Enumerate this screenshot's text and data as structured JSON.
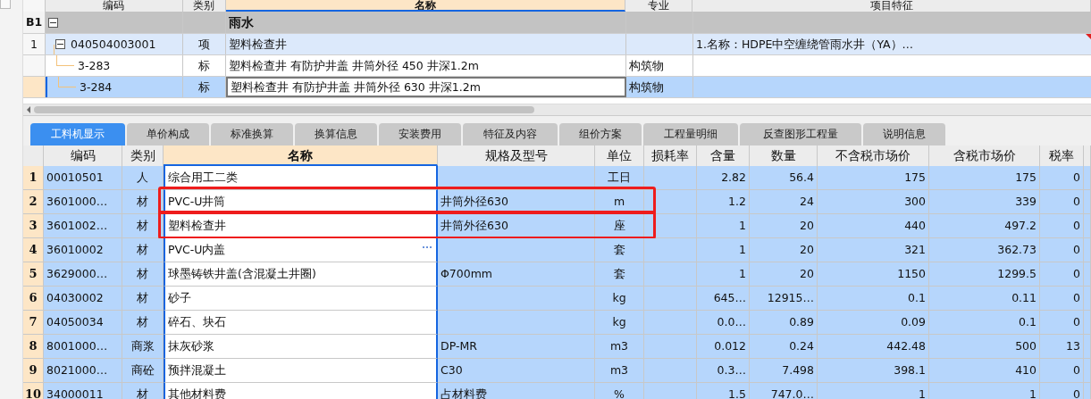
{
  "upper": {
    "columns": [
      {
        "label": "编码",
        "selected": false
      },
      {
        "label": "类别",
        "selected": false
      },
      {
        "label": "名称",
        "selected": true
      },
      {
        "label": "专业",
        "selected": false
      },
      {
        "label": "项目特征",
        "selected": false
      }
    ],
    "rows": [
      {
        "kind": "group",
        "index": "B1",
        "code": "",
        "type": "",
        "name": "雨水",
        "major": "",
        "feature": "",
        "expanded": true,
        "selected": false
      },
      {
        "kind": "item",
        "index": "1",
        "code": "040504003001",
        "type": "项",
        "name": "塑料检查井",
        "major": "",
        "feature": "1.名称：HDPE中空缠绕管雨水井（YA）…",
        "expanded": true,
        "selected": false
      },
      {
        "kind": "sub",
        "index": "",
        "code": "3-283",
        "type": "标",
        "name": "塑料检查井 有防护井盖 井筒外径 450 井深1.2m",
        "major": "构筑物",
        "feature": "",
        "selected": false
      },
      {
        "kind": "sub",
        "index": "",
        "code": "3-284",
        "type": "标",
        "name": "塑料检查井 有防护井盖 井筒外径 630 井深1.2m",
        "major": "构筑物",
        "feature": "",
        "selected": true
      }
    ]
  },
  "tabs": [
    {
      "label": "工料机显示",
      "selected": true
    },
    {
      "label": "单价构成",
      "selected": false
    },
    {
      "label": "标准换算",
      "selected": false
    },
    {
      "label": "换算信息",
      "selected": false
    },
    {
      "label": "安装费用",
      "selected": false
    },
    {
      "label": "特征及内容",
      "selected": false
    },
    {
      "label": "组价方案",
      "selected": false
    },
    {
      "label": "工程量明细",
      "selected": false
    },
    {
      "label": "反查图形工程量",
      "selected": false
    },
    {
      "label": "说明信息",
      "selected": false
    }
  ],
  "lower": {
    "columns": [
      {
        "label": "编码",
        "selected": false
      },
      {
        "label": "类别",
        "selected": false
      },
      {
        "label": "名称",
        "selected": true
      },
      {
        "label": "规格及型号",
        "selected": false
      },
      {
        "label": "单位",
        "selected": false
      },
      {
        "label": "损耗率",
        "selected": false
      },
      {
        "label": "含量",
        "selected": false
      },
      {
        "label": "数量",
        "selected": false
      },
      {
        "label": "不含税市场价",
        "selected": false
      },
      {
        "label": "含税市场价",
        "selected": false
      },
      {
        "label": "税率",
        "selected": false
      }
    ],
    "rows": [
      {
        "index": "1",
        "cells": [
          "00010501",
          "人",
          "综合用工二类",
          "",
          "工日",
          "",
          "2.82",
          "56.4",
          "175",
          "175",
          "0"
        ],
        "annotated": false,
        "more": false
      },
      {
        "index": "2",
        "cells": [
          "3601000…",
          "材",
          "PVC-U井筒",
          "井筒外径630",
          "m",
          "",
          "1.2",
          "24",
          "300",
          "339",
          "0"
        ],
        "annotated": true,
        "more": false
      },
      {
        "index": "3",
        "cells": [
          "3601002…",
          "材",
          "塑料检查井",
          "井筒外径630",
          "座",
          "",
          "1",
          "20",
          "440",
          "497.2",
          "0"
        ],
        "annotated": true,
        "more": false
      },
      {
        "index": "4",
        "cells": [
          "36010002",
          "材",
          "PVC-U内盖",
          "",
          "套",
          "",
          "1",
          "20",
          "321",
          "362.73",
          "0"
        ],
        "annotated": false,
        "more": true
      },
      {
        "index": "5",
        "cells": [
          "3629000…",
          "材",
          "球墨铸铁井盖(含混凝土井圈)",
          "Φ700mm",
          "套",
          "",
          "1",
          "20",
          "1150",
          "1299.5",
          "0"
        ],
        "annotated": false,
        "more": false
      },
      {
        "index": "6",
        "cells": [
          "04030002",
          "材",
          "砂子",
          "",
          "kg",
          "",
          "645…",
          "12915…",
          "0.1",
          "0.11",
          "0"
        ],
        "annotated": false,
        "more": false
      },
      {
        "index": "7",
        "cells": [
          "04050034",
          "材",
          "碎石、块石",
          "",
          "kg",
          "",
          "0.0…",
          "0.89",
          "0.09",
          "0.1",
          "0"
        ],
        "annotated": false,
        "more": false
      },
      {
        "index": "8",
        "cells": [
          "8001000…",
          "商浆",
          "抹灰砂浆",
          "DP-MR",
          "m3",
          "",
          "0.012",
          "0.24",
          "442.48",
          "500",
          "13"
        ],
        "annotated": false,
        "more": false
      },
      {
        "index": "9",
        "cells": [
          "8021000…",
          "商砼",
          "预拌混凝土",
          "C30",
          "m3",
          "",
          "0.3…",
          "7.498",
          "398.1",
          "410",
          "0"
        ],
        "annotated": false,
        "more": false
      },
      {
        "index": "10",
        "cells": [
          "34000011",
          "材",
          "其他材料费",
          "占材料费",
          "%",
          "",
          "1.5",
          "747.0…",
          "1",
          "1",
          "0"
        ],
        "annotated": false,
        "more": false
      }
    ]
  }
}
